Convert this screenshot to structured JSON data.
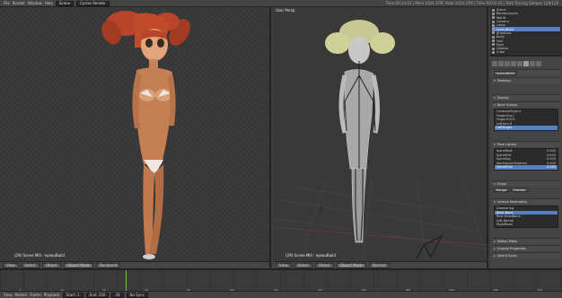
{
  "topbar": {
    "menus": [
      "File",
      "Render",
      "Window",
      "Help"
    ],
    "scene": "Scene",
    "engine": "Cycles Render",
    "info": "Time 00:14.03 | Mem 1024.37M, Peak 1024.37M | Time 00:03.33 | Path Tracing Sample 128/128"
  },
  "viewport_left": {
    "corner_label": "(29) Scene Mill : eyeouBuild",
    "header": {
      "view": "View",
      "select": "Select",
      "object": "Object",
      "mode": "Object Mode",
      "shading": "Rendered"
    }
  },
  "viewport_right": {
    "title": "User Persp",
    "corner_label": "(29) Scene Mill : eyeouBuild",
    "header": {
      "view": "View",
      "select": "Select",
      "object": "Object",
      "mode": "Object Mode",
      "global": "Normal"
    }
  },
  "outliner": {
    "rows": [
      "Scene",
      "RenderLayers",
      "World",
      "Camera",
      "Lamp",
      "eyeouBuild",
      "Armature",
      "Body",
      "Hair",
      "Eyes",
      "Clothes",
      "Cube"
    ],
    "selected_index": 5
  },
  "properties": {
    "object_name": "eyeouBuild",
    "panels": {
      "skeleton": "Skeleton",
      "display": "Display",
      "bone_groups": "Bone Groups",
      "pose_library": "Pose Library",
      "ghost": "Ghost",
      "ik": "Inverse Kinematics",
      "motion_paths": "Motion Paths",
      "custom_props": "Custom Properties",
      "inherit": "Inherit Scale"
    },
    "bone_groups": [
      "ControlsFinger.L",
      "FingerGrp.L",
      "FingerCtrl.R",
      "LeftArm.R",
      "LeftFinger"
    ],
    "bone_groups_selected": 4,
    "pose_items": [
      {
        "name": "SpineRoot",
        "value": "0.000"
      },
      {
        "name": "SpineMid",
        "value": "0.000"
      },
      {
        "name": "SpineTop",
        "value": "0.000"
      },
      {
        "name": "NeckUpperRotation",
        "value": "0.000"
      },
      {
        "name": "SpineFinal",
        "value": "0.000"
      }
    ],
    "pose_selected": 4,
    "ghost_list": [
      "Drawstring",
      "Back Bone",
      "Rest.HeadBone",
      "Left BoneA",
      "RightBone"
    ],
    "ghost_selected": 1,
    "buttons": {
      "range": "Range",
      "frames": "Frames"
    }
  },
  "timeline": {
    "numbers": [
      "0",
      "20",
      "40",
      "60",
      "80",
      "100",
      "120",
      "140",
      "160",
      "180",
      "200",
      "220",
      "240"
    ],
    "header": {
      "view": "View",
      "marker": "Marker",
      "frame": "Frame",
      "playback": "Playback",
      "start": "Start: 1",
      "end": "End: 250",
      "current": "29",
      "sync": "No Sync"
    }
  }
}
